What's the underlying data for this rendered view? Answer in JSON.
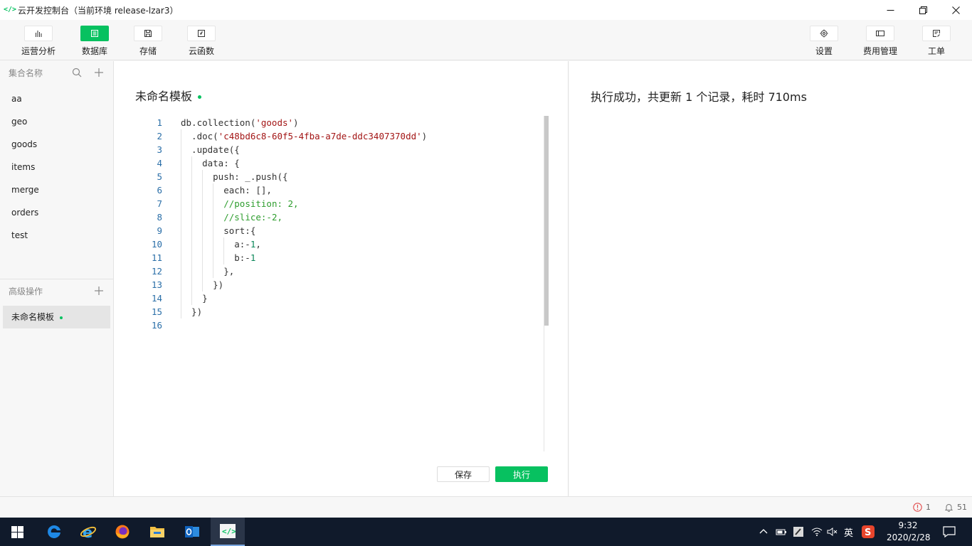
{
  "window": {
    "title": "云开发控制台（当前环境 release-lzar3）"
  },
  "toolbar": {
    "left": [
      {
        "label": "运营分析",
        "icon": "bar-chart-icon"
      },
      {
        "label": "数据库",
        "icon": "database-icon"
      },
      {
        "label": "存储",
        "icon": "storage-icon"
      },
      {
        "label": "云函数",
        "icon": "cloud-function-icon"
      }
    ],
    "right": [
      {
        "label": "设置",
        "icon": "gear-icon"
      },
      {
        "label": "费用管理",
        "icon": "billing-icon"
      },
      {
        "label": "工单",
        "icon": "ticket-icon"
      }
    ]
  },
  "sidebar": {
    "collections_header": "集合名称",
    "collections": [
      "aa",
      "geo",
      "goods",
      "items",
      "merge",
      "orders",
      "test"
    ],
    "advanced_header": "高级操作",
    "advanced_items": [
      "未命名模板"
    ]
  },
  "editor": {
    "template_title": "未命名模板",
    "save_label": "保存",
    "run_label": "执行",
    "line_numbers": [
      "1",
      "2",
      "3",
      "4",
      "5",
      "6",
      "7",
      "8",
      "9",
      "10",
      "11",
      "12",
      "13",
      "14",
      "15",
      "16"
    ],
    "lines": [
      "db.collection('goods')",
      "  .doc('c48bd6c8-60f5-4fba-a7de-ddc3407370dd')",
      "  .update({",
      "    data: {",
      "      push: _.push({",
      "        each: [],",
      "        //position: 2,",
      "        //slice:-2,",
      "        sort:{",
      "          a:-1,",
      "          b:-1",
      "        },",
      "      })",
      "    }",
      "  })",
      ""
    ]
  },
  "result": {
    "message": "执行成功，共更新 1 个记录，耗时 710ms"
  },
  "statusbar": {
    "error_count": "1",
    "notification_count": "51"
  },
  "taskbar": {
    "time": "9:32",
    "date": "2020/2/28",
    "ime": "英",
    "colors": {
      "bg": "#101a2b",
      "accent": "#07c160"
    }
  }
}
